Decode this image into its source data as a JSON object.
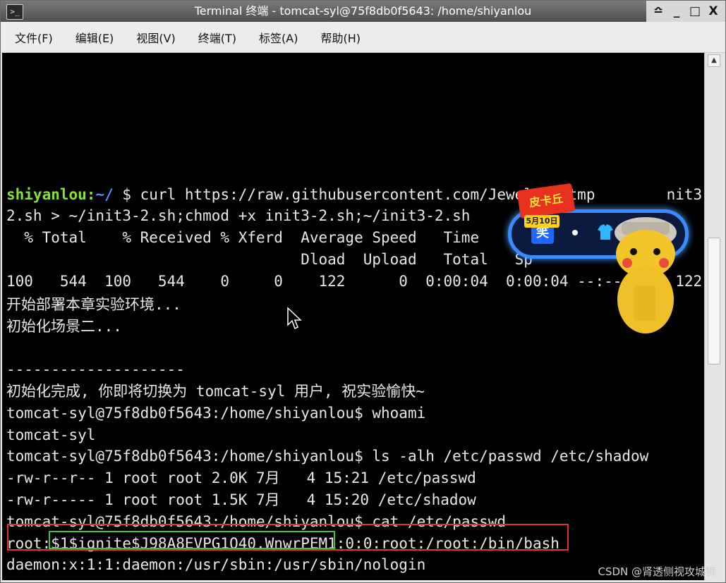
{
  "window": {
    "title": "Terminal 终端 - tomcat-syl@75f8db0f5643: /home/shiyanlou",
    "controls": [
      "≏",
      "_",
      "□",
      "X"
    ]
  },
  "menu": {
    "items": [
      "文件(F)",
      "编辑(E)",
      "视图(V)",
      "终端(T)",
      "标签(A)",
      "帮助(H)"
    ]
  },
  "terminal": {
    "prompt_user": "shiyanlou:",
    "prompt_path": "~/",
    "prompt_cmd": " $ curl https://raw.githubusercontent.com/Jewel591/tmp        nit3-",
    "lines": [
      "2.sh > ~/init3-2.sh;chmod +x init3-2.sh;~/init3-2.sh",
      "  % Total    % Received % Xferd  Average Speed   Time",
      "                                 Dload  Upload   Total   Sp",
      "100   544  100   544    0     0    122      0  0:00:04  0:00:04 --:--:--   122",
      "开始部署本章实验环境...",
      "初始化场景二...",
      "",
      "--------------------",
      "初始化完成, 你即将切换为 tomcat-syl 用户, 祝实验愉快~",
      "tomcat-syl@75f8db0f5643:/home/shiyanlou$ whoami",
      "tomcat-syl",
      "tomcat-syl@75f8db0f5643:/home/shiyanlou$ ls -alh /etc/passwd /etc/shadow",
      "-rw-r--r-- 1 root root 2.0K 7月   4 15:21 /etc/passwd",
      "-rw-r----- 1 root root 1.5K 7月   4 15:20 /etc/shadow",
      "tomcat-syl@75f8db0f5643:/home/shiyanlou$ cat /etc/passwd",
      "root:$1$ignite$J98A8EVPG1O40.WnwrPEM1:0:0:root:/root:/bin/bash",
      "daemon:x:1:1:daemon:/usr/sbin:/usr/sbin/nologin"
    ]
  },
  "ad": {
    "badge": "皮卡丘",
    "date": "5月10日",
    "icon_text": "笑",
    "icons": [
      "smile-icon",
      "shirt-icon"
    ]
  },
  "watermark": "CSDN @肾透侧视攻城狮",
  "colors": {
    "terminal_bg": "#000000",
    "terminal_fg": "#e8e8e8",
    "prompt_user": "#88e036",
    "prompt_path": "#5a8cff",
    "highlight_red": "#e33131",
    "highlight_green": "#3cc43c"
  }
}
